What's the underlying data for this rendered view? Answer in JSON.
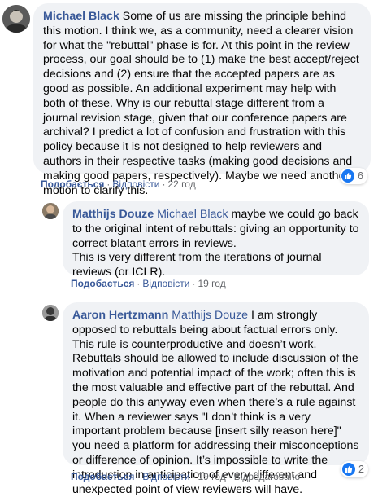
{
  "comments": [
    {
      "author": "Michael Black",
      "mention": "",
      "text": "Some of us are missing the principle behind this motion. I think we, as a community, need a clearer vision for what the \"rebuttal\" phase is for. At this point in the review process, our goal should be to (1) make the best accept/reject decisions and (2) ensure that the accepted papers are as good as possible. An additional experiment may help with both of these. Why is our rebuttal stage different from a journal revision stage, given that our conference papers are archival? I predict a lot of confusion and frustration with this policy because it is not designed to help reviewers and authors in their respective tasks (making good decisions and making good papers, respectively). Maybe we need another motion to clarify this.",
      "like_label": "Подобається",
      "reply_label": "Відповісти",
      "time": "22 год",
      "reactions": "6"
    },
    {
      "author": "Matthijs Douze",
      "mention": "Michael Black",
      "text": "maybe we could go back to the original intent of rebuttals: giving an opportunity to correct blatant errors in reviews.",
      "text2": "This is very different from the iterations of journal reviews (or ICLR).",
      "like_label": "Подобається",
      "reply_label": "Відповісти",
      "time": "19 год"
    },
    {
      "author": "Aaron Hertzmann",
      "mention": "Matthijs Douze",
      "text": "I am strongly opposed to rebuttals being about factual errors only. This rule is counterproductive and doesn’t work. Rebuttals should be allowed to include discussion of the motivation and potential impact of the work; often this is the most valuable and effective part of the rebuttal. And people do this anyway even when there’s a rule against it. When a reviewer says \"I don’t think is a very important problem because [insert silly reason here]\" you need a platform for addressing their misconceptions or difference of opinion. It’s impossible to write the introduction in anticipation of every different and unexpected point of view reviewers will have.",
      "like_label": "Подобається",
      "reply_label": "Відповісти",
      "time": "19 год",
      "edited": "Відредаговано",
      "reactions": "2"
    }
  ],
  "colors": {
    "link": "#385898",
    "bubble": "#f0f2f5",
    "meta": "#65676b",
    "like_blue": "#1877f2"
  },
  "icons": [
    "avatar",
    "like-icon"
  ]
}
